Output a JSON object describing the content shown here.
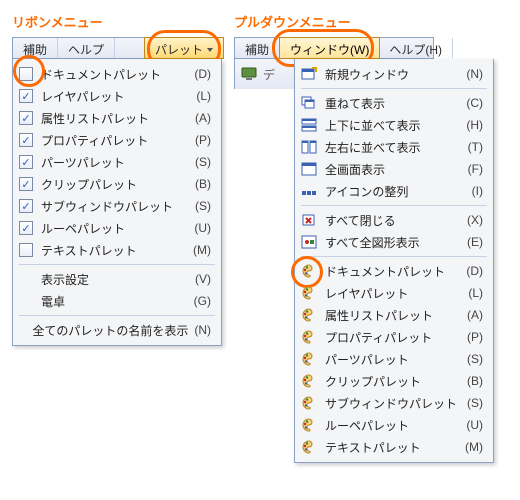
{
  "section_titles": {
    "ribbon": "リボンメニュー",
    "pulldown": "プルダウンメニュー"
  },
  "ribbon": {
    "tabs": [
      {
        "label": "補助"
      },
      {
        "label": "ヘルプ"
      },
      {
        "label": "パレット",
        "active": true,
        "has_arrow": true
      }
    ],
    "items": [
      {
        "label": "ドキュメントパレット",
        "accel": "(D)",
        "checked": false
      },
      {
        "label": "レイヤパレット",
        "accel": "(L)",
        "checked": true
      },
      {
        "label": "属性リストパレット",
        "accel": "(A)",
        "checked": true
      },
      {
        "label": "プロパティパレット",
        "accel": "(P)",
        "checked": true
      },
      {
        "label": "パーツパレット",
        "accel": "(S)",
        "checked": true
      },
      {
        "label": "クリップパレット",
        "accel": "(B)",
        "checked": true
      },
      {
        "label": "サブウィンドウパレット",
        "accel": "(S)",
        "checked": true
      },
      {
        "label": "ルーペパレット",
        "accel": "(U)",
        "checked": true
      },
      {
        "label": "テキストパレット",
        "accel": "(M)",
        "checked": false
      },
      {
        "label": "表示設定",
        "accel": "(V)"
      },
      {
        "label": "電卓",
        "accel": "(G)"
      }
    ],
    "footer_label": "全てのパレットの名前を表示",
    "footer_accel": "(N)"
  },
  "pulldown": {
    "tabs": [
      {
        "label": "補助"
      },
      {
        "label": "ウィンドウ(W)",
        "active": true
      },
      {
        "label": "ヘルプ(H)"
      }
    ],
    "aux_label": "デ",
    "groups": [
      [
        {
          "icon": "new-window-icon",
          "label": "新規ウィンドウ",
          "accel": "(N)"
        }
      ],
      [
        {
          "icon": "cascade-icon",
          "label": "重ねて表示",
          "accel": "(C)"
        },
        {
          "icon": "tile-vertical-icon",
          "label": "上下に並べて表示",
          "accel": "(H)"
        },
        {
          "icon": "tile-horizontal-icon",
          "label": "左右に並べて表示",
          "accel": "(T)"
        },
        {
          "icon": "fullscreen-icon",
          "label": "全画面表示",
          "accel": "(F)"
        },
        {
          "icon": "arrange-icons-icon",
          "label": "アイコンの整列",
          "accel": "(I)"
        }
      ],
      [
        {
          "icon": "close-all-icon",
          "label": "すべて閉じる",
          "accel": "(X)"
        },
        {
          "icon": "show-all-figures-icon",
          "label": "すべて全図形表示",
          "accel": "(E)"
        }
      ],
      [
        {
          "icon": "palette-icon",
          "label": "ドキュメントパレット",
          "accel": "(D)",
          "marker": true
        },
        {
          "icon": "palette-icon",
          "label": "レイヤパレット",
          "accel": "(L)"
        },
        {
          "icon": "palette-icon",
          "label": "属性リストパレット",
          "accel": "(A)"
        },
        {
          "icon": "palette-icon",
          "label": "プロパティパレット",
          "accel": "(P)"
        },
        {
          "icon": "palette-icon",
          "label": "パーツパレット",
          "accel": "(S)"
        },
        {
          "icon": "palette-icon",
          "label": "クリップパレット",
          "accel": "(B)"
        },
        {
          "icon": "palette-icon",
          "label": "サブウィンドウパレット",
          "accel": "(S)"
        },
        {
          "icon": "palette-icon",
          "label": "ルーペパレット",
          "accel": "(U)"
        },
        {
          "icon": "palette-icon",
          "label": "テキストパレット",
          "accel": "(M)"
        }
      ]
    ]
  },
  "colors": {
    "accent": "#ff6a00",
    "highlight_bg": "#ffe49a",
    "panel_border": "#8aa1c8"
  }
}
